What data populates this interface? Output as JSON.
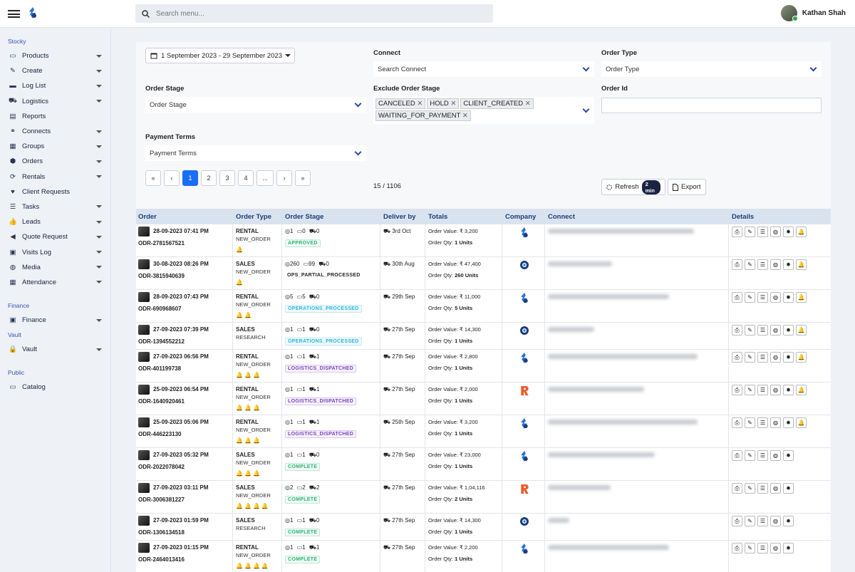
{
  "topbar": {
    "search_placeholder": "Search menu...",
    "user_name": "Kathan Shah"
  },
  "sidebar": {
    "sections": [
      {
        "title": "Stocky",
        "items": [
          {
            "label": "Products",
            "icon": "laptop-icon",
            "caret": true
          },
          {
            "label": "Create",
            "icon": "pencil-icon",
            "caret": true
          },
          {
            "label": "Log List",
            "icon": "folder-icon",
            "caret": true
          },
          {
            "label": "Logistics",
            "icon": "truck-icon",
            "caret": true
          },
          {
            "label": "Reports",
            "icon": "report-icon",
            "caret": false
          },
          {
            "label": "Connects",
            "icon": "handshake-icon",
            "caret": true
          },
          {
            "label": "Groups",
            "icon": "groups-icon",
            "caret": true
          },
          {
            "label": "Orders",
            "icon": "cube-icon",
            "caret": true
          },
          {
            "label": "Rentals",
            "icon": "sync-icon",
            "caret": true
          },
          {
            "label": "Client Requests",
            "icon": "heart-icon",
            "caret": false
          },
          {
            "label": "Tasks",
            "icon": "tasks-icon",
            "caret": true
          },
          {
            "label": "Leads",
            "icon": "thumbs-up-icon",
            "caret": true
          },
          {
            "label": "Quote Request",
            "icon": "megaphone-icon",
            "caret": true
          },
          {
            "label": "Visits Log",
            "icon": "briefcase-icon",
            "caret": true
          },
          {
            "label": "Media",
            "icon": "globe-icon",
            "caret": true
          },
          {
            "label": "Attendance",
            "icon": "calendar-icon",
            "caret": true
          }
        ]
      },
      {
        "title": "Finance",
        "items": [
          {
            "label": "Finance",
            "icon": "money-icon",
            "caret": true
          }
        ]
      },
      {
        "title": "Vault",
        "items": [
          {
            "label": "Vault",
            "icon": "lock-icon",
            "caret": true
          }
        ]
      },
      {
        "title": "Public",
        "items": [
          {
            "label": "Catalog",
            "icon": "laptop-icon",
            "caret": false
          }
        ]
      }
    ]
  },
  "filters": {
    "date_range": "1 September 2023 - 29 September 2023",
    "connect_label": "Connect",
    "connect_placeholder": "Search Connect",
    "order_type_label": "Order Type",
    "order_type_placeholder": "Order Type",
    "order_stage_label": "Order Stage",
    "order_stage_placeholder": "Order Stage",
    "exclude_label": "Exclude Order Stage",
    "exclude_tags": [
      "CANCELED",
      "HOLD",
      "CLIENT_CREATED",
      "WAITING_FOR_PAYMENT"
    ],
    "order_id_label": "Order Id",
    "payment_terms_label": "Payment Terms",
    "payment_terms_placeholder": "Payment Terms"
  },
  "pagination": {
    "first": "«",
    "prev": "‹",
    "pages": [
      "1",
      "2",
      "3",
      "4",
      "..."
    ],
    "next": "›",
    "last": "»",
    "active": "1",
    "count": "15 / 1106"
  },
  "actions": {
    "refresh": "Refresh",
    "refresh_pill": "2 min",
    "export": "Export"
  },
  "table": {
    "headers": {
      "order": "Order",
      "order_type": "Order Type",
      "order_stage": "Order Stage",
      "deliver_by": "Deliver by",
      "totals": "Totals",
      "company": "Company",
      "connect": "Connect",
      "details": "Details"
    },
    "rows": [
      {
        "datetime": "28-09-2023 07:41 PM",
        "id": "ODR-2781567521",
        "type": "RENTAL",
        "sub": "NEW_ORDER",
        "bells": [
          "#2bb673"
        ],
        "stage_counts": [
          "1",
          "0",
          "0"
        ],
        "badge": "APPROVED",
        "badge_color": "#2bb673",
        "deliver": "3rd Oct",
        "order_value": "Order Value: ₹ 3,200",
        "order_qty": "1 Units",
        "company": "stocky",
        "bell_detail": true,
        "connect_blur_w": 205
      },
      {
        "datetime": "30-08-2023 08:26 PM",
        "id": "ODR-3815940639",
        "type": "SALES",
        "sub": "NEW_ORDER",
        "bells": [
          "#2bb673"
        ],
        "stage_counts": [
          "260",
          "99",
          "0"
        ],
        "badge": "OPS_PARTIAL_PROCESSED",
        "badge_color": "#222",
        "deliver": "30th Aug",
        "order_value": "Order Value: ₹ 47,400",
        "order_qty": "260 Units",
        "company": "gear",
        "bell_detail": true,
        "connect_blur_w": 90
      },
      {
        "datetime": "28-09-2023 07:43 PM",
        "id": "ODR-690968607",
        "type": "RENTAL",
        "sub": "NEW_ORDER",
        "bells": [
          "#2bb673",
          "#29b6d9"
        ],
        "stage_counts": [
          "5",
          "5",
          "0"
        ],
        "badge": "OPERATIONS_PROCESSED",
        "badge_color": "#29b6d9",
        "deliver": "29th Sep",
        "order_value": "Order Value: ₹ 11,000",
        "order_qty": "5 Units",
        "company": "stocky",
        "bell_detail": true,
        "connect_blur_w": 170
      },
      {
        "datetime": "27-09-2023 07:39 PM",
        "id": "ODR-1394552212",
        "type": "SALES",
        "sub": "RESEARCH",
        "bells": [],
        "stage_counts": [
          "1",
          "1",
          "0"
        ],
        "badge": "OPERATIONS_PROCESSED",
        "badge_color": "#29b6d9",
        "deliver": "27th Sep",
        "order_value": "Order Value: ₹ 14,300",
        "order_qty": "1 Units",
        "company": "gear",
        "bell_detail": true,
        "connect_blur_w": 65
      },
      {
        "datetime": "27-09-2023 06:56 PM",
        "id": "ODR-401199738",
        "type": "RENTAL",
        "sub": "NEW_ORDER",
        "bells": [
          "#2bb673",
          "#7a3fc1",
          "#29b6d9"
        ],
        "stage_counts": [
          "1",
          "1",
          "1"
        ],
        "badge": "LOGISTICS_DISPATCHED",
        "badge_color": "#7a3fc1",
        "deliver": "27th Sep",
        "order_value": "Order Value: ₹ 2,800",
        "order_qty": "1 Units",
        "company": "stocky",
        "bell_detail": true,
        "connect_blur_w": 210
      },
      {
        "datetime": "25-09-2023 06:54 PM",
        "id": "ODR-1640920461",
        "type": "RENTAL",
        "sub": "NEW_ORDER",
        "bells": [
          "#2bb673",
          "#7a3fc1",
          "#29b6d9"
        ],
        "stage_counts": [
          "1",
          "1",
          "1"
        ],
        "badge": "LOGISTICS_DISPATCHED",
        "badge_color": "#7a3fc1",
        "deliver": "27th Sep",
        "order_value": "Order Value: ₹ 2,000",
        "order_qty": "1 Units",
        "company": "r-logo",
        "bell_detail": true,
        "connect_blur_w": 135
      },
      {
        "datetime": "25-09-2023 05:06 PM",
        "id": "ODR-446223130",
        "type": "RENTAL",
        "sub": "NEW_ORDER",
        "bells": [
          "#2bb673",
          "#7a3fc1",
          "#29b6d9"
        ],
        "stage_counts": [
          "1",
          "1",
          "1"
        ],
        "badge": "LOGISTICS_DISPATCHED",
        "badge_color": "#7a3fc1",
        "deliver": "25th Sep",
        "order_value": "Order Value: ₹ 3,200",
        "order_qty": "1 Units",
        "company": "stocky",
        "bell_detail": true,
        "connect_blur_w": 210
      },
      {
        "datetime": "27-09-2023 05:32 PM",
        "id": "ODR-2022078042",
        "type": "SALES",
        "sub": "NEW_ORDER",
        "bells": [
          "#2bb673",
          "#2bb673",
          "#2bb673"
        ],
        "stage_counts": [
          "1",
          "1",
          "0"
        ],
        "badge": "COMPLETE",
        "badge_color": "#2bb673",
        "deliver": "27th Sep",
        "order_value": "Order Value: ₹ 23,000",
        "order_qty": "1 Units",
        "company": "stocky",
        "bell_detail": false,
        "connect_blur_w": 150
      },
      {
        "datetime": "27-09-2023 03:11 PM",
        "id": "ODR-3006381227",
        "type": "SALES",
        "sub": "NEW_ORDER",
        "bells": [
          "#2bb673",
          "#2bb673",
          "#7a3fc1",
          "#29b6d9"
        ],
        "stage_counts": [
          "2",
          "2",
          "2"
        ],
        "badge": "COMPLETE",
        "badge_color": "#2bb673",
        "deliver": "27th Sep",
        "order_value": "Order Value: ₹ 1,04,116",
        "order_qty": "2 Units",
        "company": "r-logo",
        "bell_detail": false,
        "connect_blur_w": 88
      },
      {
        "datetime": "27-09-2023 01:59 PM",
        "id": "ODR-1306134518",
        "type": "SALES",
        "sub": "RESEARCH",
        "bells": [],
        "stage_counts": [
          "1",
          "1",
          "0"
        ],
        "badge": "COMPLETE",
        "badge_color": "#2bb673",
        "deliver": "27th Sep",
        "order_value": "Order Value: ₹ 14,300",
        "order_qty": "1 Units",
        "company": "gear",
        "bell_detail": false,
        "connect_blur_w": 30
      },
      {
        "datetime": "27-09-2023 01:15 PM",
        "id": "ODR-2464013416",
        "type": "RENTAL",
        "sub": "NEW_ORDER",
        "bells": [
          "#2bb673",
          "#2bb673",
          "#7a3fc1",
          "#29b6d9"
        ],
        "stage_counts": [
          "1",
          "1",
          "1"
        ],
        "badge": "COMPLETE",
        "badge_color": "#2bb673",
        "deliver": "27th Sep",
        "order_value": "Order Value: ₹ 2,200",
        "order_qty": "1 Units",
        "company": "stocky",
        "bell_detail": false,
        "connect_blur_w": 170
      }
    ],
    "qty_label": "Order Qty:"
  },
  "colors": {
    "accent": "#1a6ef5",
    "header_text": "#1c3d7a",
    "header_bg": "#d9e3ef",
    "sidebar_section": "#3a55a8"
  }
}
